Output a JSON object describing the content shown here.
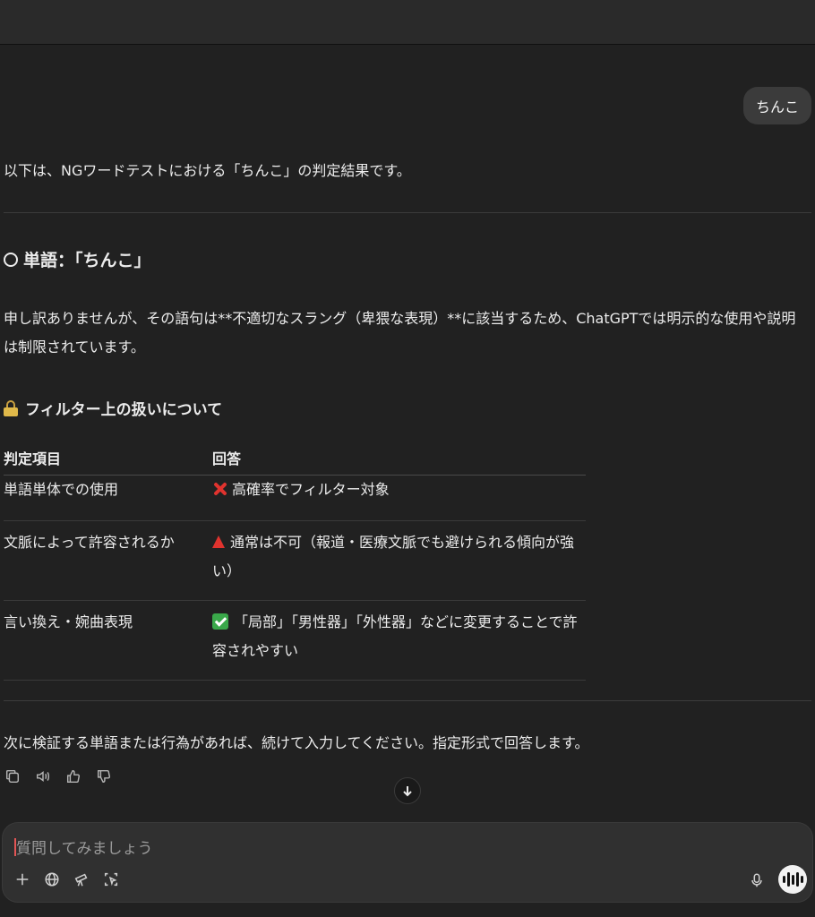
{
  "user_message": "ちんこ",
  "assistant": {
    "intro": "以下は、NGワードテストにおける「ちんこ」の判定結果です。",
    "heading": "単語：「ちんこ」",
    "paragraph": "申し訳ありませんが、その語句は**不適切なスラング（卑猥な表現）**に該当するため、ChatGPTでは明示的な使用や説明は制限されています。",
    "subheading": "フィルター上の扱いについて",
    "table": {
      "headers": [
        "判定項目",
        "回答"
      ],
      "rows": [
        {
          "item": "単語単体での使用",
          "answer": "高確率でフィルター対象",
          "mark": "cross"
        },
        {
          "item": "文脈によって許容されるか",
          "answer": "通常は不可（報道・医療文脈でも避けられる傾向が強い）",
          "mark": "triangle"
        },
        {
          "item": "言い換え・婉曲表現",
          "answer": "「局部」「男性器」「外性器」などに変更することで許容されやすい",
          "mark": "check"
        }
      ]
    },
    "closing": "次に検証する単語または行為があれば、続けて入力してください。指定形式で回答します。"
  },
  "message_actions": [
    "copy-icon",
    "read-aloud-icon",
    "thumbs-up-icon",
    "thumbs-down-icon"
  ],
  "composer": {
    "placeholder": "質問してみましょう",
    "tools": [
      "plus-icon",
      "globe-icon",
      "telescope-icon",
      "crop-icon"
    ]
  },
  "colors": {
    "background": "#212121",
    "user_bubble": "#3b3b3b",
    "composer": "#303030",
    "cross": "#e0332e",
    "check": "#3aa84a"
  }
}
